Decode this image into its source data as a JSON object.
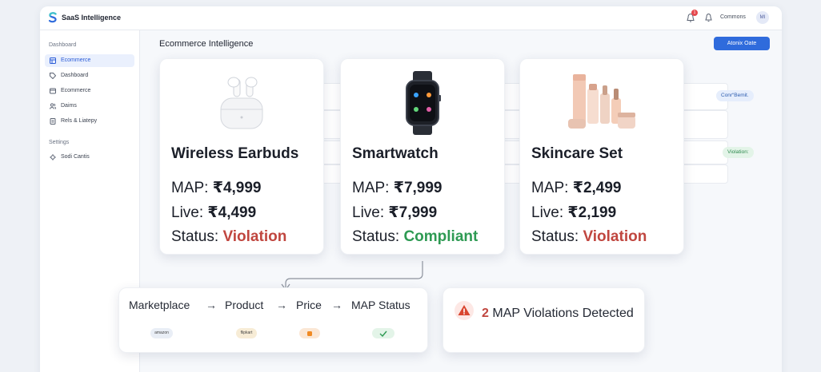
{
  "app": {
    "title": "SaaS Intelligence",
    "notification_count": "1",
    "user_name": "Commons",
    "user_initials": "MI"
  },
  "sidebar": {
    "sections": [
      {
        "heading": "Dashboard",
        "items": [
          {
            "label": "Ecommerce",
            "icon": "grid-icon",
            "active": true
          },
          {
            "label": "Dashboard",
            "icon": "tag-icon"
          },
          {
            "label": "Ecommerce",
            "icon": "card-icon"
          },
          {
            "label": "Daims",
            "icon": "users-icon"
          },
          {
            "label": "Rels & Liatepy",
            "icon": "document-icon"
          }
        ]
      },
      {
        "heading": "Settings",
        "items": [
          {
            "label": "Sodi Cantis",
            "icon": "gear-icon"
          }
        ]
      }
    ]
  },
  "main": {
    "title": "Ecommerce Intelligence",
    "action_label": "Atonix Oate"
  },
  "background_pills": [
    "Conr“Bemit.",
    "Violation:"
  ],
  "products": [
    {
      "name": "Wireless Earbuds",
      "map_label": "MAP:",
      "map": "₹4,999",
      "live_label": "Live:",
      "live": "₹4,499",
      "status_label": "Status:",
      "status": "Violation",
      "image": "earbuds-image"
    },
    {
      "name": "Smartwatch",
      "map_label": "MAP:",
      "map": "₹7,999",
      "live_label": "Live:",
      "live": "₹7,999",
      "status_label": "Status:",
      "status": "Compliant",
      "image": "smartwatch-image"
    },
    {
      "name": "Skincare Set",
      "map_label": "MAP:",
      "map": "₹2,499",
      "live_label": "Live:",
      "live": "₹2,199",
      "status_label": "Status:",
      "status": "Violation",
      "image": "skincare-image"
    }
  ],
  "flow": {
    "steps": [
      "Marketplace",
      "Product",
      "Price",
      "MAP Status"
    ],
    "chips": [
      "amazon",
      "flipkart",
      "",
      "check-icon"
    ]
  },
  "alert": {
    "count": "2",
    "text": "MAP Violations Detected"
  },
  "colors": {
    "accent": "#2f6bdc",
    "violation": "#c0463f",
    "compliant": "#2e9a53"
  }
}
